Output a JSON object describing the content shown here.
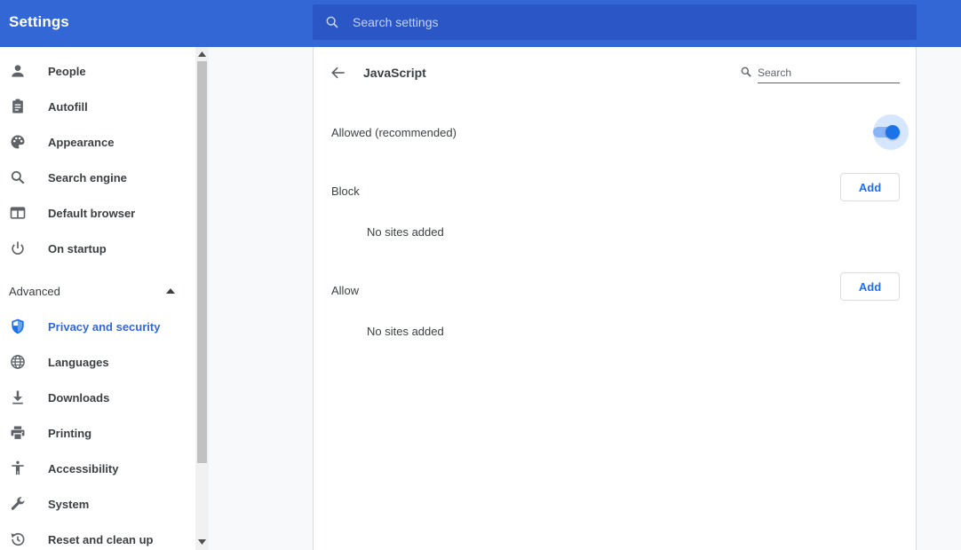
{
  "app": {
    "title": "Settings",
    "search_placeholder": "Search settings"
  },
  "sidebar": {
    "items": [
      {
        "label": "People",
        "icon": "person-icon"
      },
      {
        "label": "Autofill",
        "icon": "clipboard-icon"
      },
      {
        "label": "Appearance",
        "icon": "palette-icon"
      },
      {
        "label": "Search engine",
        "icon": "search-icon"
      },
      {
        "label": "Default browser",
        "icon": "browser-window-icon"
      },
      {
        "label": "On startup",
        "icon": "power-icon"
      }
    ],
    "advanced_label": "Advanced",
    "advanced_items": [
      {
        "label": "Privacy and security",
        "icon": "shield-icon",
        "active": true
      },
      {
        "label": "Languages",
        "icon": "globe-icon"
      },
      {
        "label": "Downloads",
        "icon": "download-icon"
      },
      {
        "label": "Printing",
        "icon": "printer-icon"
      },
      {
        "label": "Accessibility",
        "icon": "accessibility-icon"
      },
      {
        "label": "System",
        "icon": "wrench-icon"
      },
      {
        "label": "Reset and clean up",
        "icon": "history-icon"
      }
    ]
  },
  "page": {
    "title": "JavaScript",
    "search_placeholder": "Search",
    "allowed_label": "Allowed (recommended)",
    "allowed_enabled": true,
    "block": {
      "label": "Block",
      "add_label": "Add",
      "empty_text": "No sites added"
    },
    "allow": {
      "label": "Allow",
      "add_label": "Add",
      "empty_text": "No sites added"
    }
  },
  "colors": {
    "header": "#3367d6",
    "accent": "#1a73e8",
    "active_nav": "#3367d6"
  }
}
